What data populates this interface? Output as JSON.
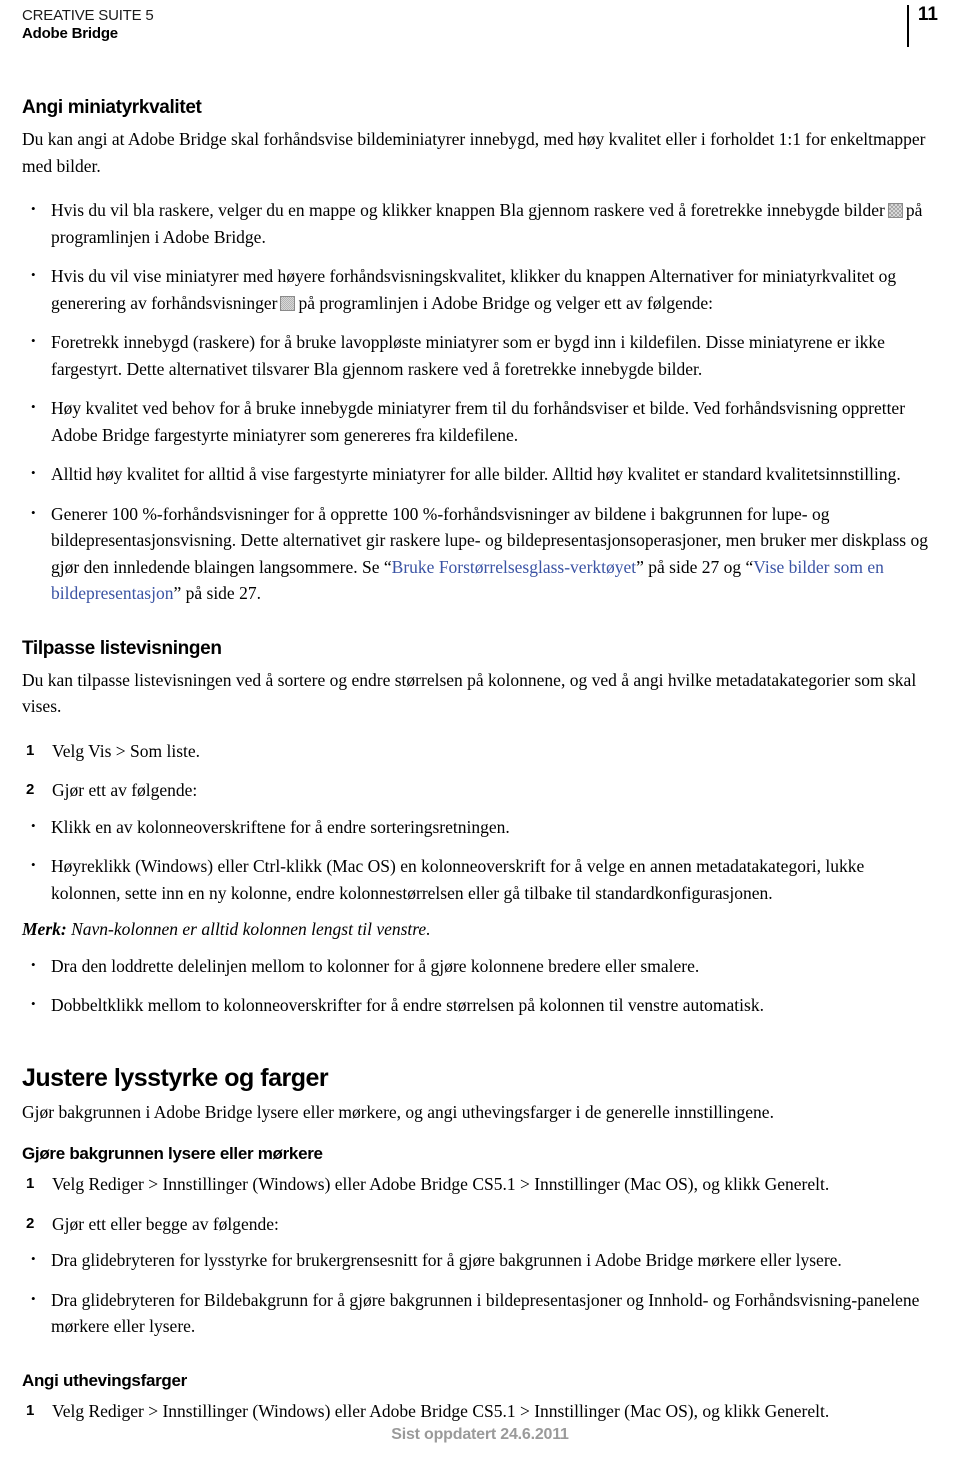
{
  "header": {
    "suite_title": "CREATIVE SUITE 5",
    "product": "Adobe Bridge",
    "page_number": "11"
  },
  "sections": {
    "thumb_quality": {
      "heading": "Angi miniatyrkvalitet",
      "intro": "Du kan angi at Adobe Bridge skal forhåndsvise bildeminiatyrer innebygd, med høy kvalitet eller i forholdet 1:1 for enkeltmapper med bilder.",
      "bullet_1_a": "Hvis du vil bla raskere, velger du en mappe og klikker knappen Bla gjennom raskere ved å foretrekke innebygde bilder",
      "bullet_1_b": "på programlinjen i Adobe Bridge.",
      "bullet_2_a": "Hvis du vil vise miniatyrer med høyere forhåndsvisningskvalitet, klikker du knappen Alternativer for miniatyrkvalitet og generering av forhåndsvisninger",
      "bullet_2_b": "på programlinjen i Adobe Bridge og velger ett av følgende:",
      "bullet_3": "Foretrekk innebygd (raskere) for å bruke lavoppløste miniatyrer som er bygd inn i kildefilen. Disse miniatyrene er ikke fargestyrt. Dette alternativet tilsvarer Bla gjennom raskere ved å foretrekke innebygde bilder.",
      "bullet_4": "Høy kvalitet ved behov for å bruke innebygde miniatyrer frem til du forhåndsviser et bilde. Ved forhåndsvisning oppretter Adobe Bridge fargestyrte miniatyrer som genereres fra kildefilene.",
      "bullet_5": "Alltid høy kvalitet for alltid å vise fargestyrte miniatyrer for alle bilder. Alltid høy kvalitet er standard kvalitetsinnstilling.",
      "bullet_6_p1": "Generer 100 %-forhåndsvisninger for å opprette 100 %-forhåndsvisninger av bildene i bakgrunnen for lupe- og bildepresentasjonsvisning. Dette alternativet gir raskere lupe- og bildepresentasjonsoperasjoner, men bruker mer diskplass og gjør den innledende blaingen langsommere. Se “",
      "bullet_6_link1": "Bruke Forstørrelsesglass-verktøyet",
      "bullet_6_p2": "” på side 27 og “",
      "bullet_6_link2": "Vise bilder som en bildepresentasjon",
      "bullet_6_p3": "” på side 27."
    },
    "list_view": {
      "heading": "Tilpasse listevisningen",
      "intro": "Du kan tilpasse listevisningen ved å sortere og endre størrelsen på kolonnene, og ved å angi hvilke metadatakategorier som skal vises.",
      "step_1_num": "1",
      "step_1": "Velg Vis > Som liste.",
      "step_2_num": "2",
      "step_2": "Gjør ett av følgende:",
      "bullet_1": "Klikk en av kolonneoverskriftene for å endre sorteringsretningen.",
      "bullet_2": "Høyreklikk (Windows) eller Ctrl-klikk (Mac OS) en kolonneoverskrift for å velge en annen metadatakategori, lukke kolonnen, sette inn en ny kolonne, endre kolonnestørrelsen eller gå tilbake til standardkonfigurasjonen.",
      "note_label": "Merk:",
      "note_text": " Navn-kolonnen er alltid kolonnen lengst til venstre.",
      "bullet_3": "Dra den loddrette delelinjen mellom to kolonner for å gjøre kolonnene bredere eller smalere.",
      "bullet_4": "Dobbeltklikk mellom to kolonneoverskrifter for å endre størrelsen på kolonnen til venstre automatisk."
    },
    "brightness": {
      "heading": "Justere lysstyrke og farger",
      "intro": "Gjør bakgrunnen i Adobe Bridge lysere eller mørkere, og angi uthevingsfarger i de generelle innstillingene."
    },
    "background": {
      "heading": "Gjøre bakgrunnen lysere eller mørkere",
      "step_1_num": "1",
      "step_1": "Velg Rediger > Innstillinger (Windows) eller Adobe Bridge CS5.1 > Innstillinger (Mac OS), og klikk Generelt.",
      "step_2_num": "2",
      "step_2": "Gjør ett eller begge av følgende:",
      "bullet_1": "Dra glidebryteren for lysstyrke for brukergrensesnitt for å gjøre bakgrunnen i Adobe Bridge mørkere eller lysere.",
      "bullet_2": "Dra glidebryteren for Bildebakgrunn for å gjøre bakgrunnen i bildepresentasjoner og Innhold- og Forhåndsvisning-panelene mørkere eller lysere."
    },
    "highlight": {
      "heading": "Angi uthevingsfarger",
      "step_1_num": "1",
      "step_1": "Velg Rediger > Innstillinger (Windows) eller Adobe Bridge CS5.1 > Innstillinger (Mac OS), og klikk Generelt."
    }
  },
  "footer": {
    "text": "Sist oppdatert 24.6.2011"
  },
  "colors": {
    "link": "#3a53a4",
    "footer_text": "#9a9a9a",
    "body_text": "#000000"
  }
}
